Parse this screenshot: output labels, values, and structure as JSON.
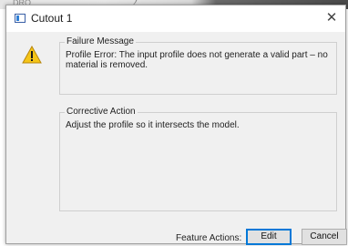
{
  "background": {
    "label": "DRO"
  },
  "dialog": {
    "title": "Cutout 1",
    "close_glyph": "✕",
    "warning_icon": "warning-icon",
    "failure": {
      "heading": "Failure Message",
      "text": "Profile Error: The input profile does not generate a valid part – no material is removed."
    },
    "corrective": {
      "heading": "Corrective Action",
      "text": "Adjust the profile so it intersects the model."
    },
    "footer": {
      "label": "Feature Actions:",
      "edit_label": "Edit",
      "cancel_label": "Cancel"
    }
  },
  "colors": {
    "dialog_bg": "#f0f0f0",
    "focus_border": "#0078d7",
    "warning_fill": "#f5c518"
  }
}
